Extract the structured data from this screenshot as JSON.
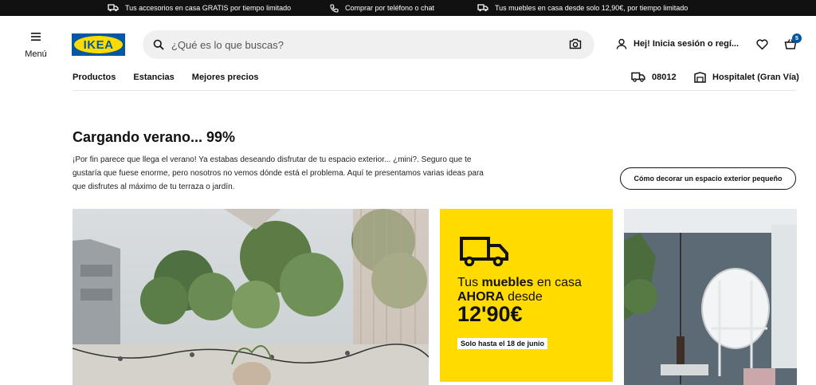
{
  "topbar": {
    "msg1": "Tus accesorios en casa GRATIS por tiempo limitado",
    "msg2": "Comprar por teléfono o chat",
    "msg3": "Tus muebles en casa desde solo 12,90€, por tiempo limitado"
  },
  "header": {
    "menu_label": "Menú",
    "logo_text": "IKEA",
    "search_placeholder": "¿Qué es lo que buscas?",
    "login_label": "Hej! Inicia sesión o regí...",
    "cart_count": "5"
  },
  "nav": {
    "items": [
      "Productos",
      "Estancias",
      "Mejores precios"
    ],
    "postcode": "08012",
    "store": "Hospitalet (Gran Vía)"
  },
  "main": {
    "title": "Cargando verano... 99%",
    "intro": "¡Por fin parece que llega el verano! Ya estabas deseando disfrutar de tu espacio exterior... ¿mini?. Seguro que te gustaría que fuese enorme, pero nosotros no vemos dónde está el problema. Aquí te presentamos varias ideas para que disfrutes al máximo de tu terraza o jardín.",
    "cta": "Cómo decorar un espacio exterior pequeño"
  },
  "promo": {
    "text_a": "Tus ",
    "text_b": "muebles",
    "text_c": " en casa",
    "text_d": "AHORA",
    "text_e": " desde",
    "price": "12'90€",
    "tag": "Solo hasta el 18 de junio"
  },
  "colors": {
    "brand_blue": "#0058a3",
    "brand_yellow": "#ffdb00"
  }
}
